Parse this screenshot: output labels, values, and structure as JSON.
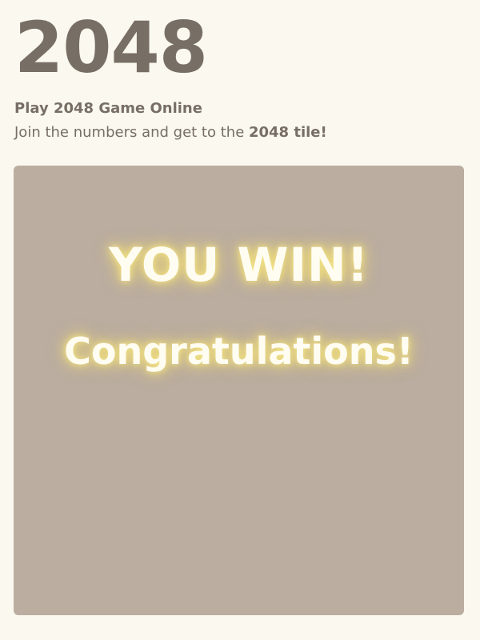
{
  "header": {
    "title": "2048",
    "subtitle": "Play 2048 Game Online",
    "intro_prefix": "Join the numbers and get to the ",
    "intro_bold": "2048 tile!"
  },
  "game": {
    "win_message": "YOU WIN!",
    "win_subtitle": "Congratulations!"
  },
  "colors": {
    "background": "#faf8ef",
    "text": "#776e65",
    "board": "#bbada0",
    "win_text": "#fffdf2",
    "win_glow": "#edd873"
  }
}
